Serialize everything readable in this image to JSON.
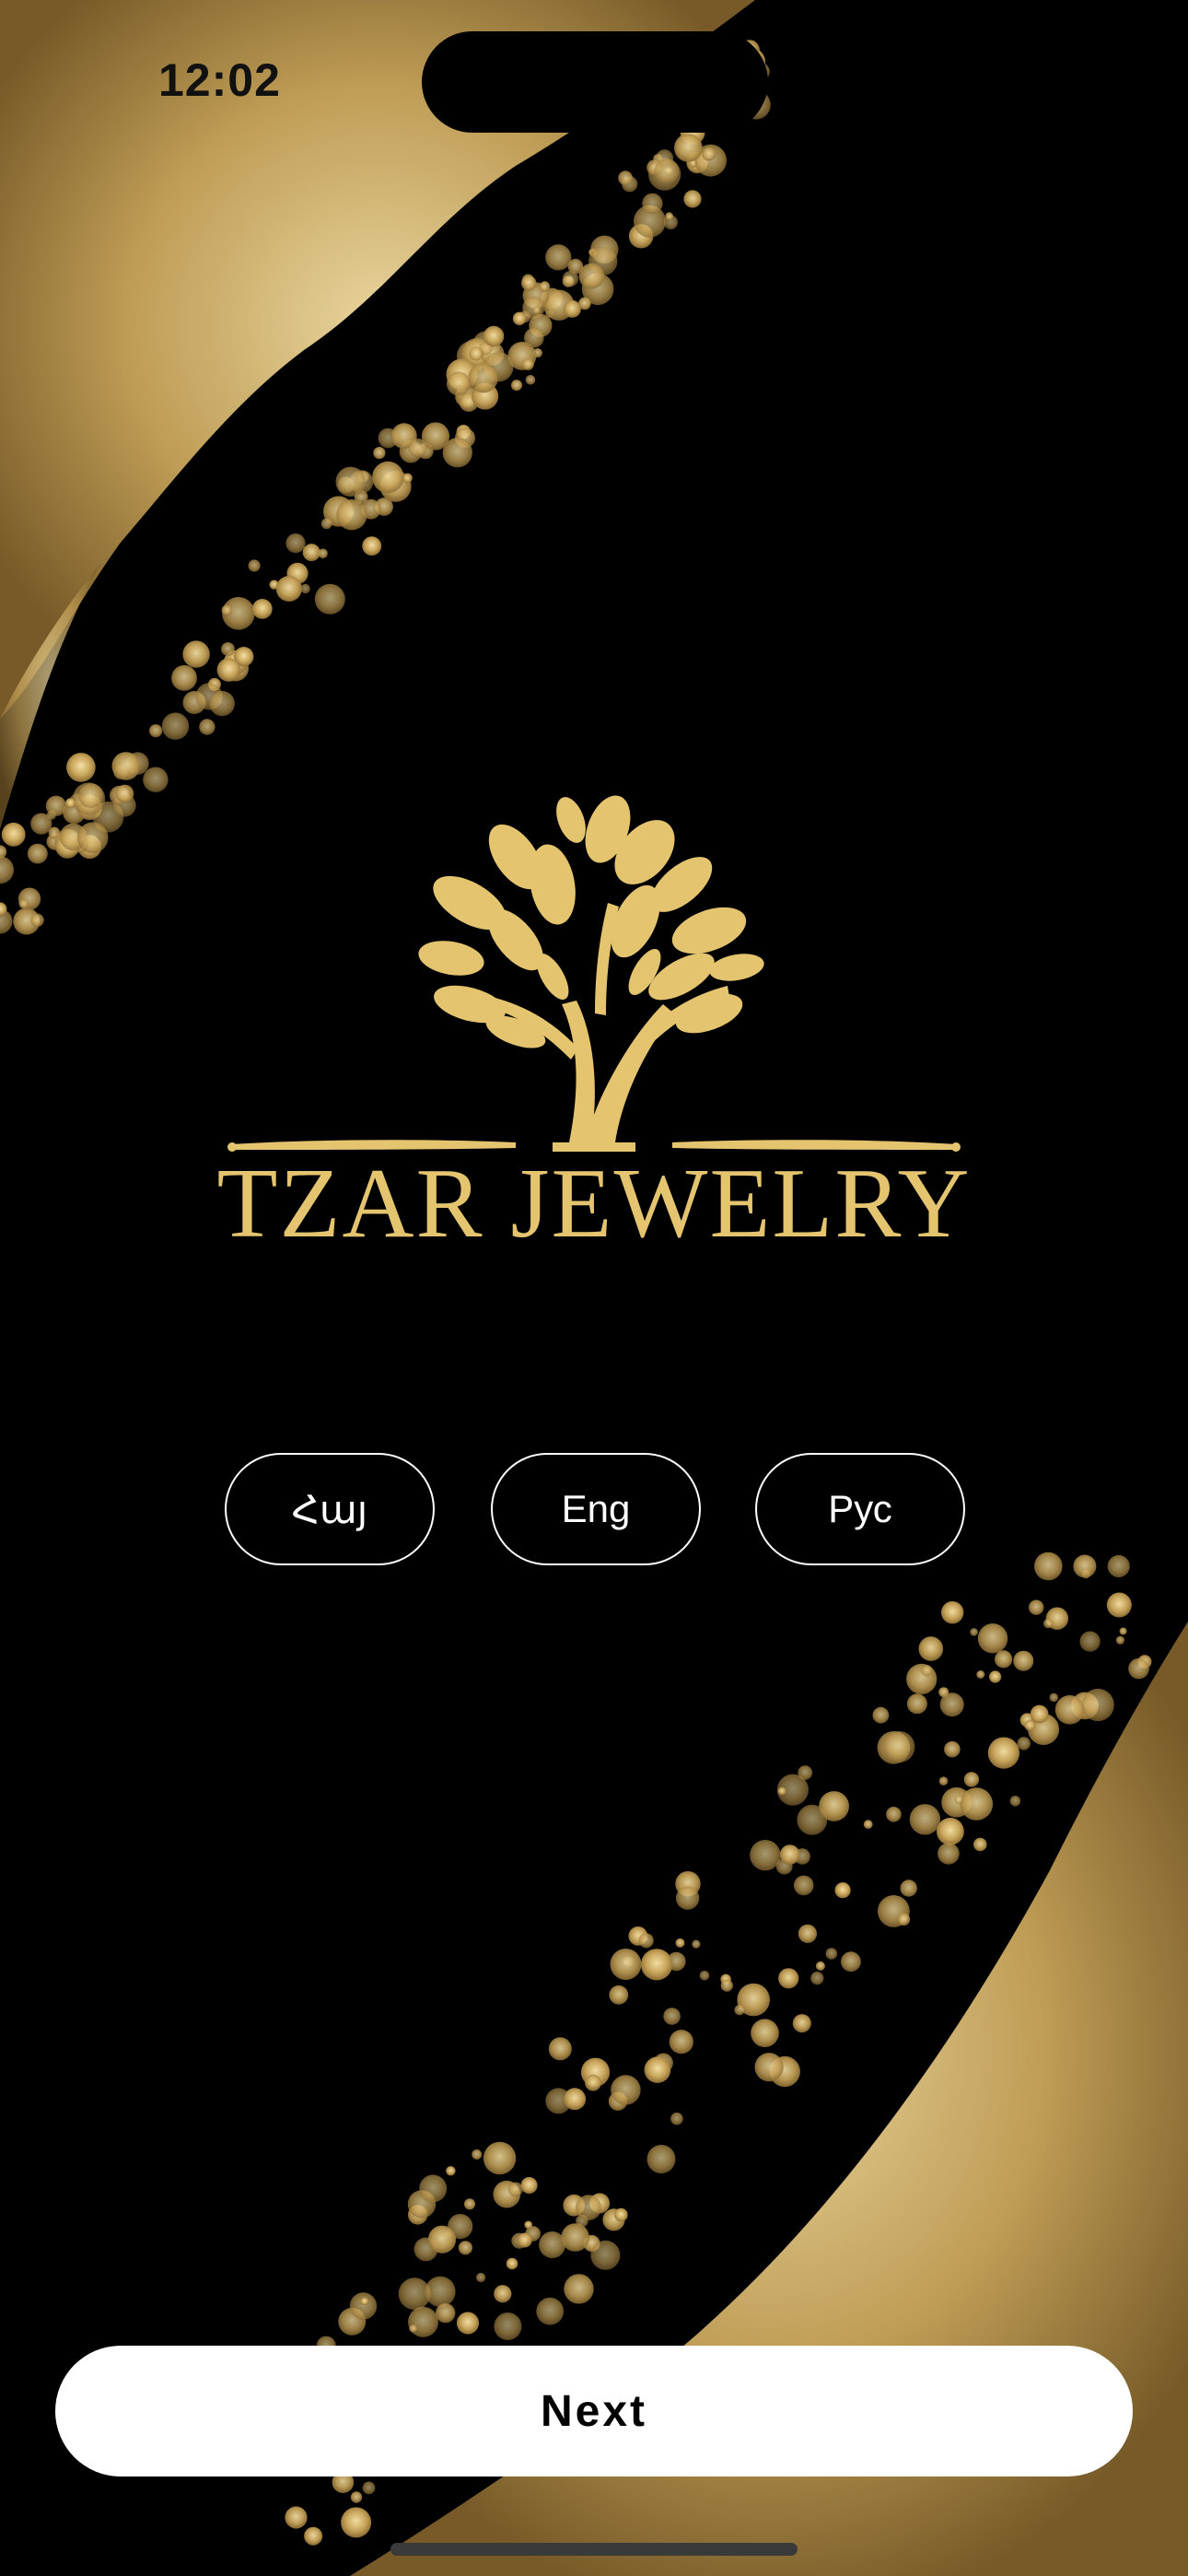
{
  "status_bar": {
    "time": "12:02"
  },
  "brand": {
    "name": "TZAR JEWELRY",
    "logo_icon": "tree-icon",
    "color": "#e5c470"
  },
  "languages": {
    "options": [
      "Հայ",
      "Eng",
      "Рус"
    ]
  },
  "actions": {
    "next_label": "Next"
  },
  "theme": {
    "background": "#000000",
    "accent": "#e5c470",
    "button_bg": "#ffffff"
  }
}
